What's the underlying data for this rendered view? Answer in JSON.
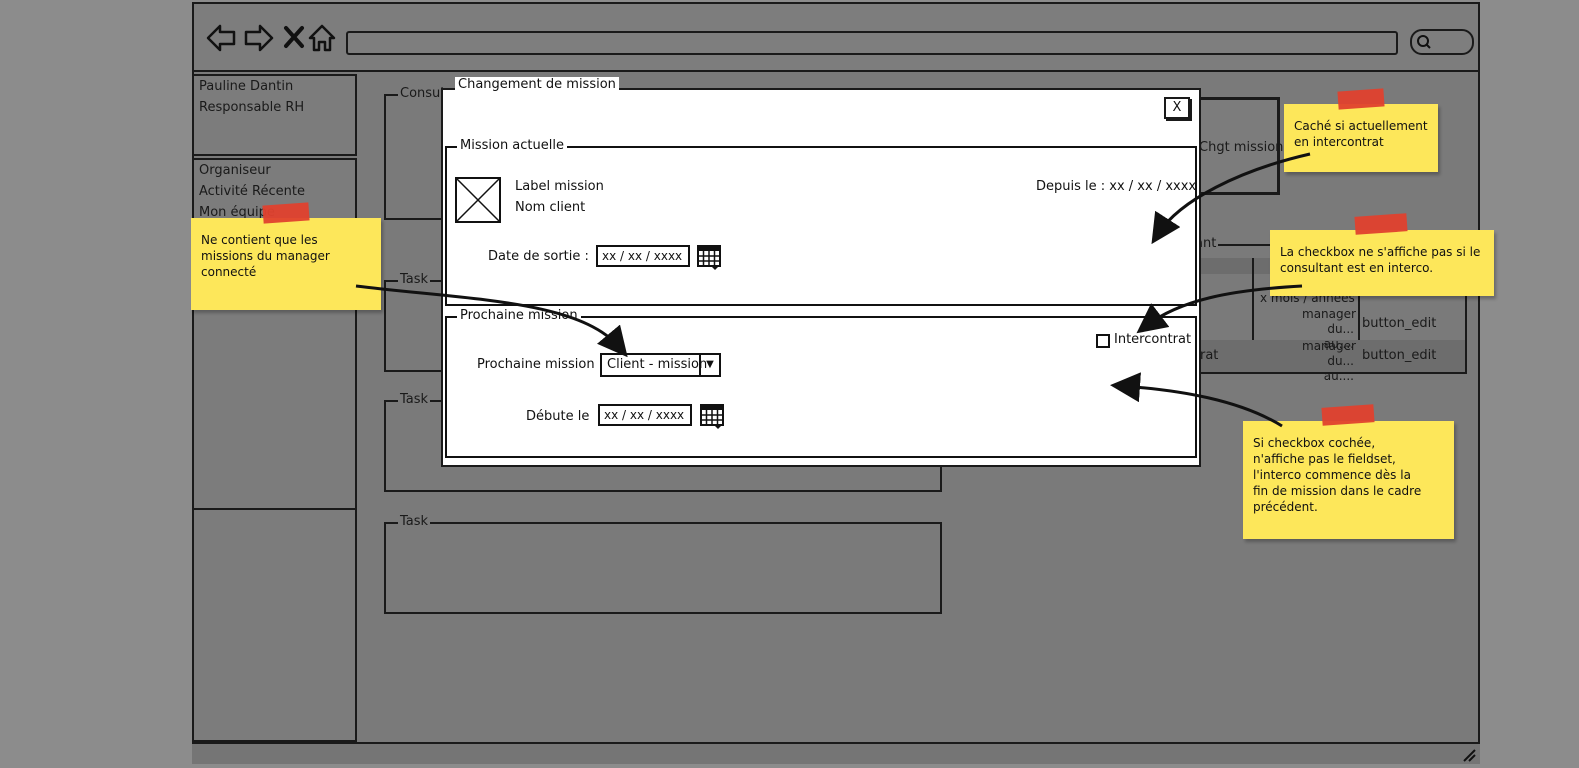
{
  "browser": {
    "back_icon": "back-arrow-icon",
    "forward_icon": "forward-arrow-icon",
    "stop_icon": "close-x-icon",
    "home_icon": "home-icon",
    "url": "",
    "search_icon": "search-icon"
  },
  "user_panel": {
    "name": "Pauline Dantin",
    "role": "Responsable RH"
  },
  "menu": {
    "items": [
      {
        "label": "Organiseur"
      },
      {
        "label": "Activité Récente"
      },
      {
        "label": "Mon équipe"
      }
    ]
  },
  "background": {
    "consultant_legend": "Consul",
    "chgt_mission_button": "Chgt mission",
    "table_legend": "ant",
    "table_rows": [
      {
        "col1": "x mois / années",
        "col2": "",
        "col3": ""
      },
      {
        "col0": "",
        "col1": "manager du... au....",
        "col2": "button_edit"
      },
      {
        "col0": "rat",
        "col1": "manager du... au....",
        "col2": "button_edit"
      }
    ],
    "task_legends": [
      "Task",
      "Task",
      "Task"
    ]
  },
  "modal": {
    "title": "Changement de mission",
    "close_label": "X",
    "current_mission": {
      "legend": "Mission actuelle",
      "label_mission": "Label mission",
      "client_name": "Nom client",
      "since": "Depuis le : xx / xx / xxxx",
      "exit_date_label": "Date de sortie :",
      "exit_date_value": "xx / xx / xxxx"
    },
    "next_mission": {
      "legend": "Prochaine mission",
      "intercontrat_label": "Intercontrat",
      "intercontrat_checked": false,
      "next_mission_label": "Prochaine mission",
      "next_mission_value": "Client - mission",
      "start_label": "Débute le",
      "start_value": "xx / xx / xxxx"
    }
  },
  "stickies": [
    {
      "text": "Ne contient que les missions du manager connecté"
    },
    {
      "text": "Caché si actuellement en intercontrat"
    },
    {
      "text": "La checkbox ne s'affiche pas si le consultant est en interco."
    },
    {
      "text": "Si checkbox cochée, n'affiche pas le fieldset, l'interco commence dès la fin de mission dans le cadre précédent."
    }
  ],
  "colors": {
    "sticky": "#fde75a",
    "tape": "#e0412e",
    "overlay": "#8c8c8c"
  }
}
